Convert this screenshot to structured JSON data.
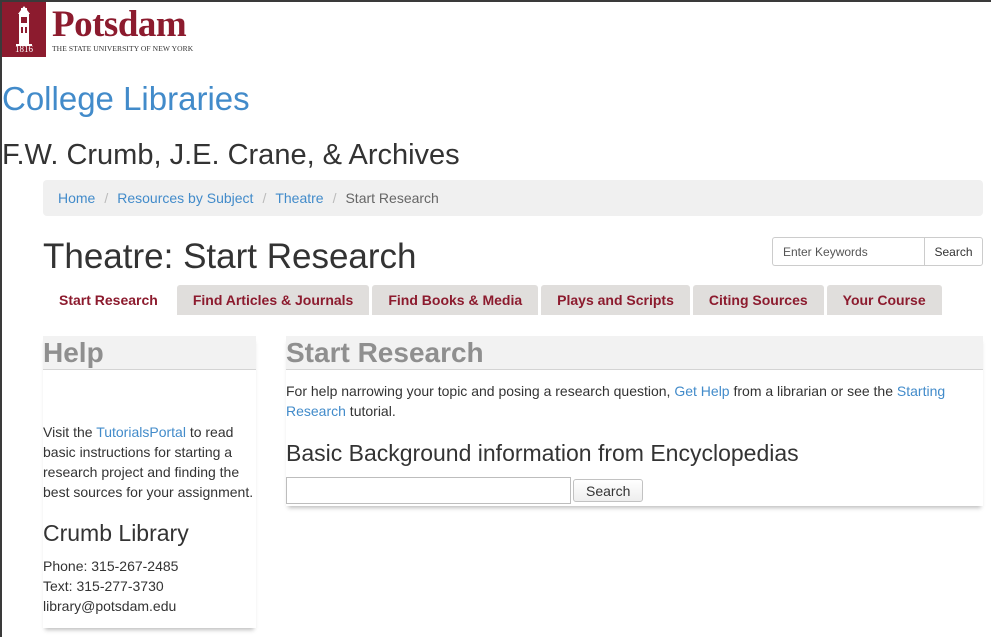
{
  "logo": {
    "wordmark": "Potsdam",
    "subtitle": "THE STATE UNIVERSITY OF NEW YORK",
    "year": "1816",
    "brand_color": "#8c1b2e"
  },
  "site_title": "College Libraries",
  "branch_title": "F.W. Crumb, J.E. Crane, & Archives",
  "breadcrumb": {
    "home": "Home",
    "subject": "Resources by Subject",
    "guide": "Theatre",
    "current": "Start Research",
    "separator": "/"
  },
  "page_title": "Theatre: Start Research",
  "search": {
    "placeholder": "Enter Keywords",
    "button_label": "Search"
  },
  "tabs": [
    {
      "label": "Start Research",
      "active": true
    },
    {
      "label": "Find Articles & Journals",
      "active": false
    },
    {
      "label": "Find Books & Media",
      "active": false
    },
    {
      "label": "Plays and Scripts",
      "active": false
    },
    {
      "label": "Citing Sources",
      "active": false
    },
    {
      "label": "Your Course",
      "active": false
    }
  ],
  "help": {
    "heading": "Help",
    "text_before": "Visit the ",
    "link": "TutorialsPortal",
    "text_after": " to read basic instructions for starting a research project and finding the best sources for your assignment.",
    "library_title": "Crumb Library",
    "phone": "Phone: 315-267-2485",
    "text": "Text: 315-277-3730",
    "email": "library@potsdam.edu"
  },
  "start_research": {
    "heading": "Start Research",
    "intro_before": "For help narrowing your topic and posing a research question, ",
    "get_help_link": "Get Help",
    "intro_middle": " from a librarian or see the ",
    "starting_research_link": "Starting Research",
    "intro_after": " tutorial.",
    "encyclopedia_title": "Basic Background information from Encyclopedias",
    "encyclopedia_input_value": "",
    "encyclopedia_button": "Search"
  },
  "colors": {
    "link": "#428bca",
    "tab_text": "#8c1b2e",
    "tab_bg": "#e0dedc",
    "panel_heading_text": "#8f8f8f"
  }
}
